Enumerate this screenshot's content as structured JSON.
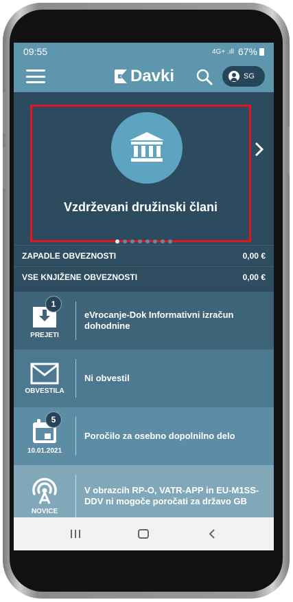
{
  "status_bar": {
    "time": "09:55",
    "signal": "4G+ .ıll",
    "battery": "67%"
  },
  "header": {
    "app_name": "Davki",
    "user_initials": "SG"
  },
  "carousel": {
    "title": "Vzdrževani družinski člani",
    "page_count": 8,
    "active_index": 0
  },
  "summary": [
    {
      "label": "ZAPADLE OBVEZNOSTI",
      "value": "0,00 €"
    },
    {
      "label": "VSE KNJIŽENE OBVEZNOSTI",
      "value": "0,00 €"
    }
  ],
  "list": [
    {
      "caption": "PREJETI",
      "badge": "1",
      "text": "eVrocanje-Dok Informativni izračun dohodnine",
      "icon": "inbox-download-icon"
    },
    {
      "caption": "OBVESTILA",
      "badge": "",
      "text": "Ni obvestil",
      "icon": "envelope-icon"
    },
    {
      "caption": "10.01.2021",
      "badge": "5",
      "text": "Poročilo za osebno dopolnilno delo",
      "icon": "calendar-icon"
    },
    {
      "caption": "NOVICE",
      "badge": "",
      "text": "V obrazcih RP-O, VATR-APP in EU-M1SS-DDV ni mogoče poročati za državo GB",
      "icon": "broadcast-icon"
    }
  ],
  "colors": {
    "header": "#5d96ad",
    "screen_bg": "#2c4b5e",
    "highlight": "#e6141e"
  }
}
